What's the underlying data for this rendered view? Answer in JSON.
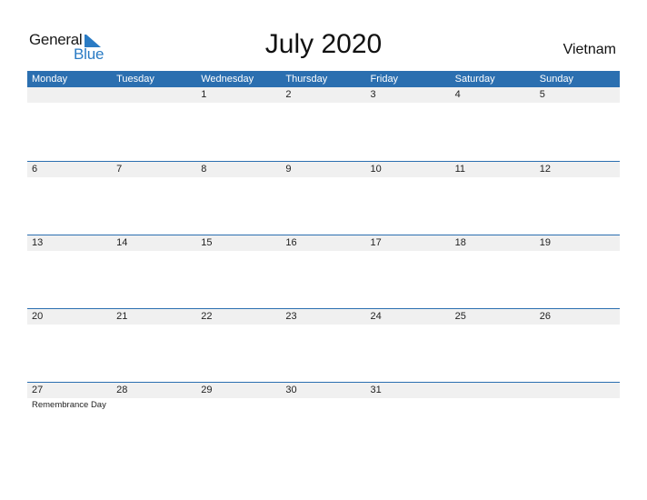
{
  "logo": {
    "general": "General",
    "blue": "Blue",
    "icon": "blue-triangle-flag-icon"
  },
  "title": "July 2020",
  "country": "Vietnam",
  "colors": {
    "header_bg": "#2b6fb0",
    "band_bg": "#f0f0f0",
    "logo_blue": "#2a7bc4"
  },
  "weekdays": [
    "Monday",
    "Tuesday",
    "Wednesday",
    "Thursday",
    "Friday",
    "Saturday",
    "Sunday"
  ],
  "weeks": [
    {
      "days": [
        {
          "num": "",
          "event": ""
        },
        {
          "num": "",
          "event": ""
        },
        {
          "num": "1",
          "event": ""
        },
        {
          "num": "2",
          "event": ""
        },
        {
          "num": "3",
          "event": ""
        },
        {
          "num": "4",
          "event": ""
        },
        {
          "num": "5",
          "event": ""
        }
      ]
    },
    {
      "days": [
        {
          "num": "6",
          "event": ""
        },
        {
          "num": "7",
          "event": ""
        },
        {
          "num": "8",
          "event": ""
        },
        {
          "num": "9",
          "event": ""
        },
        {
          "num": "10",
          "event": ""
        },
        {
          "num": "11",
          "event": ""
        },
        {
          "num": "12",
          "event": ""
        }
      ]
    },
    {
      "days": [
        {
          "num": "13",
          "event": ""
        },
        {
          "num": "14",
          "event": ""
        },
        {
          "num": "15",
          "event": ""
        },
        {
          "num": "16",
          "event": ""
        },
        {
          "num": "17",
          "event": ""
        },
        {
          "num": "18",
          "event": ""
        },
        {
          "num": "19",
          "event": ""
        }
      ]
    },
    {
      "days": [
        {
          "num": "20",
          "event": ""
        },
        {
          "num": "21",
          "event": ""
        },
        {
          "num": "22",
          "event": ""
        },
        {
          "num": "23",
          "event": ""
        },
        {
          "num": "24",
          "event": ""
        },
        {
          "num": "25",
          "event": ""
        },
        {
          "num": "26",
          "event": ""
        }
      ]
    },
    {
      "days": [
        {
          "num": "27",
          "event": "Remembrance Day"
        },
        {
          "num": "28",
          "event": ""
        },
        {
          "num": "29",
          "event": ""
        },
        {
          "num": "30",
          "event": ""
        },
        {
          "num": "31",
          "event": ""
        },
        {
          "num": "",
          "event": ""
        },
        {
          "num": "",
          "event": ""
        }
      ]
    }
  ]
}
